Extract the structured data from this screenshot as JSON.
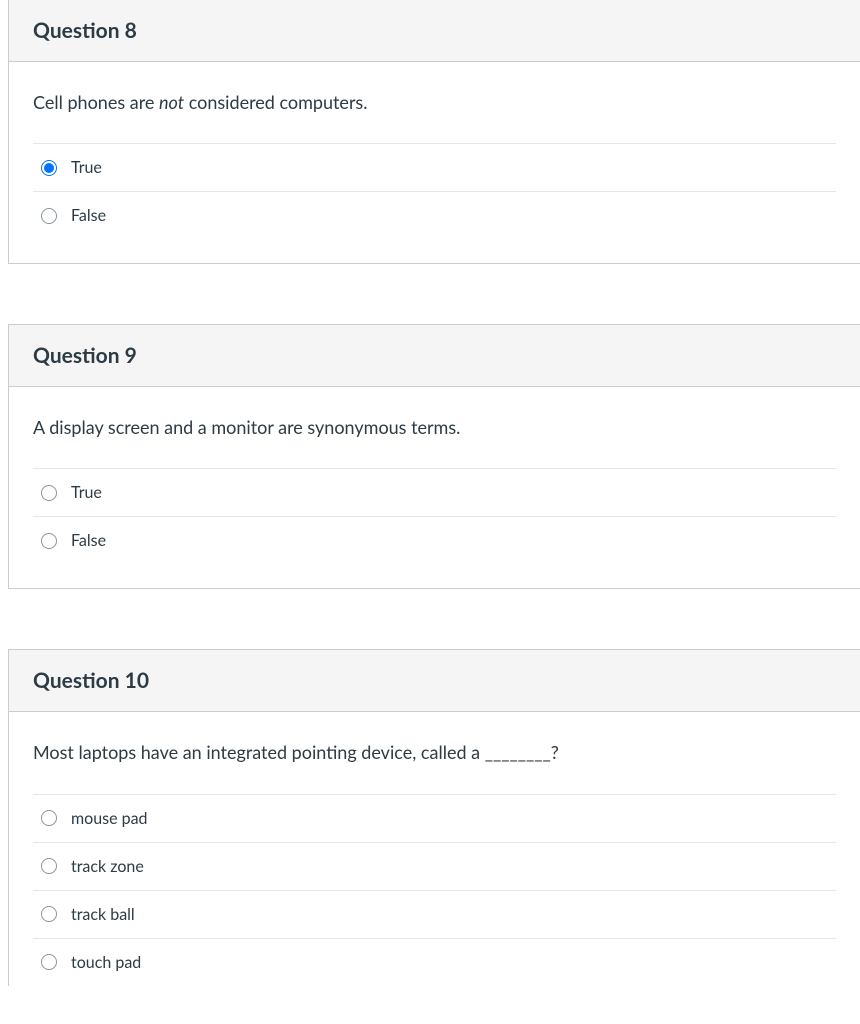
{
  "questions": [
    {
      "title": "Question 8",
      "prompt_pre": "Cell phones are ",
      "prompt_em": "not",
      "prompt_post": " considered computers.",
      "options": [
        {
          "label": "True",
          "selected": true
        },
        {
          "label": "False",
          "selected": false
        }
      ]
    },
    {
      "title": "Question 9",
      "prompt_plain": "A display screen and a monitor are synonymous terms.",
      "options": [
        {
          "label": "True",
          "selected": false
        },
        {
          "label": "False",
          "selected": false
        }
      ]
    },
    {
      "title": "Question 10",
      "prompt_plain": "Most laptops have an integrated pointing device, called a ________?",
      "options": [
        {
          "label": "mouse pad",
          "selected": false
        },
        {
          "label": "track zone",
          "selected": false
        },
        {
          "label": "track ball",
          "selected": false
        },
        {
          "label": "touch pad",
          "selected": false
        }
      ]
    }
  ]
}
